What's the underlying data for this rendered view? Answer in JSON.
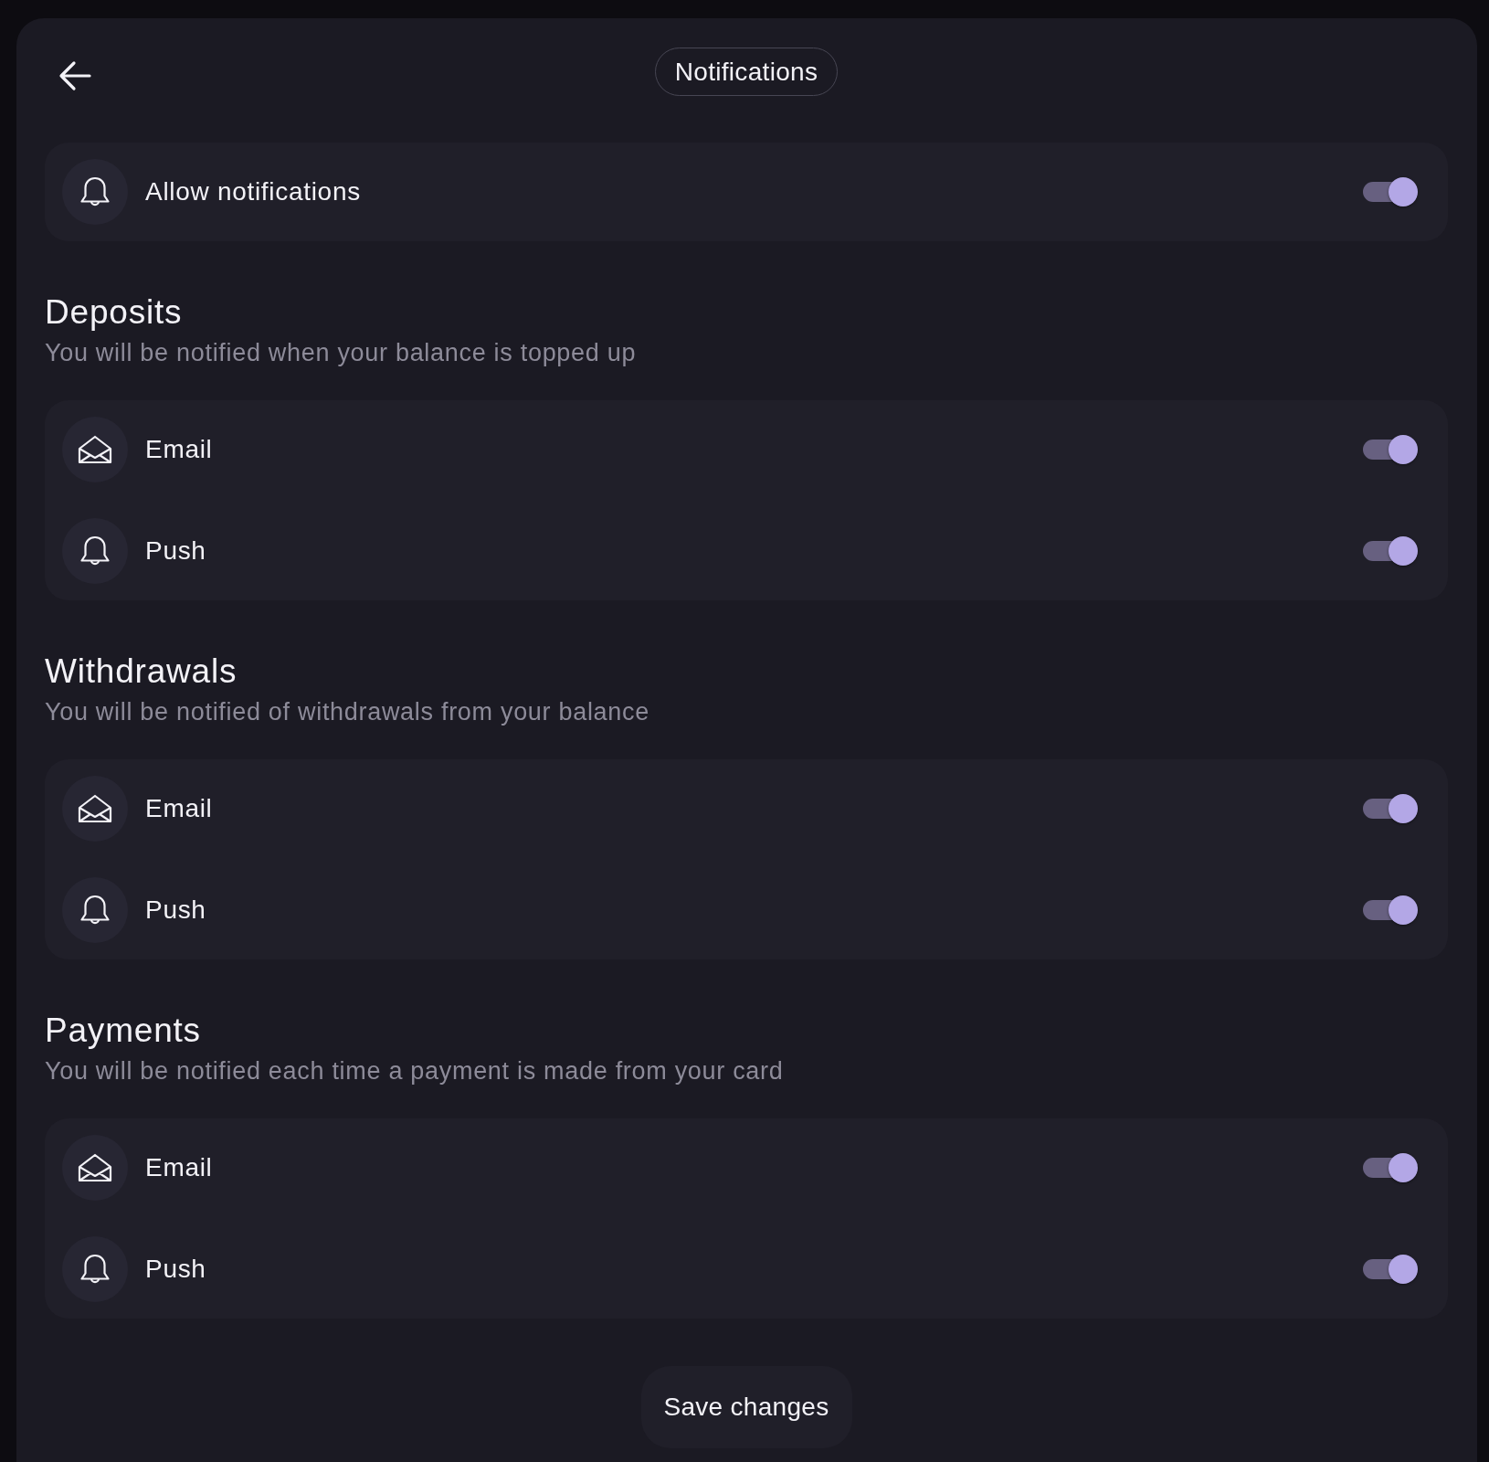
{
  "title": "Notifications",
  "allow_notifications": {
    "label": "Allow notifications",
    "on": true
  },
  "sections": [
    {
      "title": "Deposits",
      "description": "You will be notified when your balance is topped up",
      "channels": [
        {
          "kind": "email",
          "label": "Email",
          "on": true
        },
        {
          "kind": "push",
          "label": "Push",
          "on": true
        }
      ]
    },
    {
      "title": "Withdrawals",
      "description": "You will be notified of withdrawals from your balance",
      "channels": [
        {
          "kind": "email",
          "label": "Email",
          "on": true
        },
        {
          "kind": "push",
          "label": "Push",
          "on": true
        }
      ]
    },
    {
      "title": "Payments",
      "description": "You will be notified each time a payment is made from your card",
      "channels": [
        {
          "kind": "email",
          "label": "Email",
          "on": true
        },
        {
          "kind": "push",
          "label": "Push",
          "on": true
        }
      ]
    }
  ],
  "save_button": {
    "label": "Save changes"
  }
}
